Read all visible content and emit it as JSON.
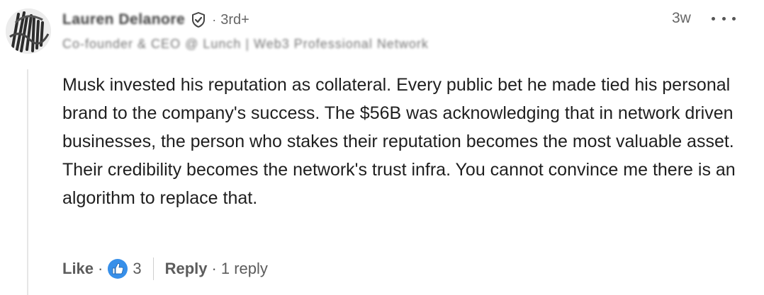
{
  "comment": {
    "author": {
      "name": "Lauren Delanore",
      "degree": "3rd+",
      "headline": "Co-founder & CEO @ Lunch | Web3 Professional Network"
    },
    "timestamp": "3w",
    "text": "Musk invested his reputation as collateral. Every public bet he made tied his personal brand to the company's success. The $56B was acknowledging that in network driven businesses, the person who stakes their reputation becomes the most valuable asset. Their credibility becomes the network's trust infra. You cannot convince me there is an algorithm to replace that.",
    "actions": {
      "like_label": "Like",
      "separator": "·",
      "reaction_count": "3",
      "reply_label": "Reply",
      "replies": "1 reply"
    },
    "icons": {
      "avatar": "avatar-photo",
      "verified": "verified-shield-icon",
      "more": "more-options-icon",
      "reaction": "thumbs-up-reaction-icon"
    },
    "colors": {
      "reaction_blue": "#378fe9",
      "text_primary": "#1f1f1f",
      "text_secondary": "#5c5c5c"
    }
  }
}
